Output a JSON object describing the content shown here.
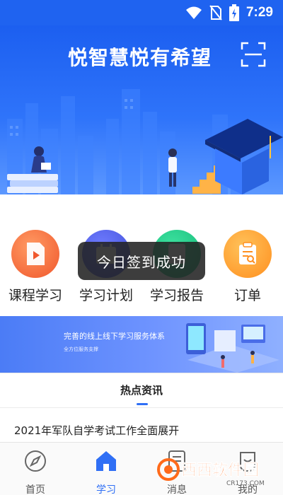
{
  "status_bar": {
    "time": "7:29"
  },
  "banner": {
    "title": "悦智慧悦有希望"
  },
  "categories": [
    {
      "label": "课程学习",
      "icon": "video-file-icon"
    },
    {
      "label": "学习计划",
      "icon": "calendar-icon"
    },
    {
      "label": "学习报告",
      "icon": "report-icon"
    },
    {
      "label": "订单",
      "icon": "order-clipboard-icon"
    }
  ],
  "toast": {
    "text": "今日签到成功"
  },
  "promo": {
    "title": "完善的线上线下学习服务体系",
    "subtitle": "全方位服务支撑"
  },
  "section": {
    "title": "热点资讯"
  },
  "news": [
    {
      "title": "2021年军队自学考试工作全面展开"
    }
  ],
  "bottom_nav": [
    {
      "label": "首页",
      "icon": "compass-icon",
      "active": false
    },
    {
      "label": "学习",
      "icon": "home-icon",
      "active": true
    },
    {
      "label": "消息",
      "icon": "message-icon",
      "active": false
    },
    {
      "label": "我的",
      "icon": "user-icon",
      "active": false
    }
  ],
  "watermark": {
    "text": "西西软件园",
    "url": "CR173.COM"
  },
  "colors": {
    "primary": "#2f6ff5",
    "banner": "#1f63f0"
  }
}
